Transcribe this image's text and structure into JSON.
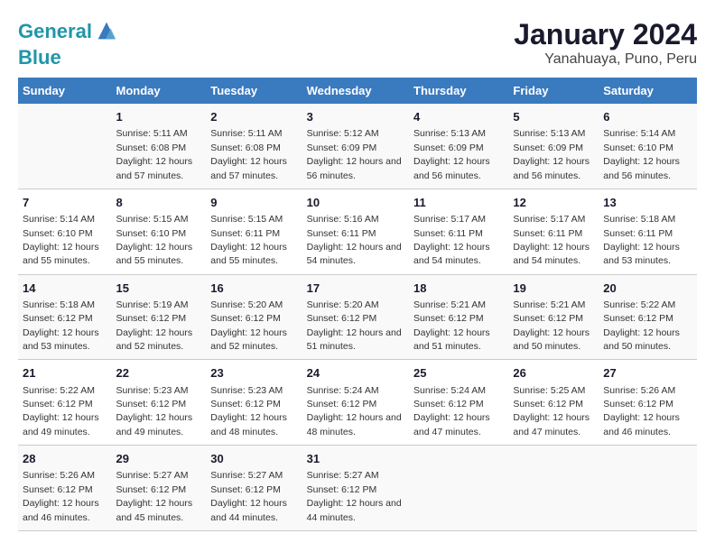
{
  "logo": {
    "line1": "General",
    "line2": "Blue"
  },
  "title": "January 2024",
  "subtitle": "Yanahuaya, Puno, Peru",
  "days_header": [
    "Sunday",
    "Monday",
    "Tuesday",
    "Wednesday",
    "Thursday",
    "Friday",
    "Saturday"
  ],
  "weeks": [
    [
      {
        "num": "",
        "sunrise": "",
        "sunset": "",
        "daylight": ""
      },
      {
        "num": "1",
        "sunrise": "Sunrise: 5:11 AM",
        "sunset": "Sunset: 6:08 PM",
        "daylight": "Daylight: 12 hours and 57 minutes."
      },
      {
        "num": "2",
        "sunrise": "Sunrise: 5:11 AM",
        "sunset": "Sunset: 6:08 PM",
        "daylight": "Daylight: 12 hours and 57 minutes."
      },
      {
        "num": "3",
        "sunrise": "Sunrise: 5:12 AM",
        "sunset": "Sunset: 6:09 PM",
        "daylight": "Daylight: 12 hours and 56 minutes."
      },
      {
        "num": "4",
        "sunrise": "Sunrise: 5:13 AM",
        "sunset": "Sunset: 6:09 PM",
        "daylight": "Daylight: 12 hours and 56 minutes."
      },
      {
        "num": "5",
        "sunrise": "Sunrise: 5:13 AM",
        "sunset": "Sunset: 6:09 PM",
        "daylight": "Daylight: 12 hours and 56 minutes."
      },
      {
        "num": "6",
        "sunrise": "Sunrise: 5:14 AM",
        "sunset": "Sunset: 6:10 PM",
        "daylight": "Daylight: 12 hours and 56 minutes."
      }
    ],
    [
      {
        "num": "7",
        "sunrise": "Sunrise: 5:14 AM",
        "sunset": "Sunset: 6:10 PM",
        "daylight": "Daylight: 12 hours and 55 minutes."
      },
      {
        "num": "8",
        "sunrise": "Sunrise: 5:15 AM",
        "sunset": "Sunset: 6:10 PM",
        "daylight": "Daylight: 12 hours and 55 minutes."
      },
      {
        "num": "9",
        "sunrise": "Sunrise: 5:15 AM",
        "sunset": "Sunset: 6:11 PM",
        "daylight": "Daylight: 12 hours and 55 minutes."
      },
      {
        "num": "10",
        "sunrise": "Sunrise: 5:16 AM",
        "sunset": "Sunset: 6:11 PM",
        "daylight": "Daylight: 12 hours and 54 minutes."
      },
      {
        "num": "11",
        "sunrise": "Sunrise: 5:17 AM",
        "sunset": "Sunset: 6:11 PM",
        "daylight": "Daylight: 12 hours and 54 minutes."
      },
      {
        "num": "12",
        "sunrise": "Sunrise: 5:17 AM",
        "sunset": "Sunset: 6:11 PM",
        "daylight": "Daylight: 12 hours and 54 minutes."
      },
      {
        "num": "13",
        "sunrise": "Sunrise: 5:18 AM",
        "sunset": "Sunset: 6:11 PM",
        "daylight": "Daylight: 12 hours and 53 minutes."
      }
    ],
    [
      {
        "num": "14",
        "sunrise": "Sunrise: 5:18 AM",
        "sunset": "Sunset: 6:12 PM",
        "daylight": "Daylight: 12 hours and 53 minutes."
      },
      {
        "num": "15",
        "sunrise": "Sunrise: 5:19 AM",
        "sunset": "Sunset: 6:12 PM",
        "daylight": "Daylight: 12 hours and 52 minutes."
      },
      {
        "num": "16",
        "sunrise": "Sunrise: 5:20 AM",
        "sunset": "Sunset: 6:12 PM",
        "daylight": "Daylight: 12 hours and 52 minutes."
      },
      {
        "num": "17",
        "sunrise": "Sunrise: 5:20 AM",
        "sunset": "Sunset: 6:12 PM",
        "daylight": "Daylight: 12 hours and 51 minutes."
      },
      {
        "num": "18",
        "sunrise": "Sunrise: 5:21 AM",
        "sunset": "Sunset: 6:12 PM",
        "daylight": "Daylight: 12 hours and 51 minutes."
      },
      {
        "num": "19",
        "sunrise": "Sunrise: 5:21 AM",
        "sunset": "Sunset: 6:12 PM",
        "daylight": "Daylight: 12 hours and 50 minutes."
      },
      {
        "num": "20",
        "sunrise": "Sunrise: 5:22 AM",
        "sunset": "Sunset: 6:12 PM",
        "daylight": "Daylight: 12 hours and 50 minutes."
      }
    ],
    [
      {
        "num": "21",
        "sunrise": "Sunrise: 5:22 AM",
        "sunset": "Sunset: 6:12 PM",
        "daylight": "Daylight: 12 hours and 49 minutes."
      },
      {
        "num": "22",
        "sunrise": "Sunrise: 5:23 AM",
        "sunset": "Sunset: 6:12 PM",
        "daylight": "Daylight: 12 hours and 49 minutes."
      },
      {
        "num": "23",
        "sunrise": "Sunrise: 5:23 AM",
        "sunset": "Sunset: 6:12 PM",
        "daylight": "Daylight: 12 hours and 48 minutes."
      },
      {
        "num": "24",
        "sunrise": "Sunrise: 5:24 AM",
        "sunset": "Sunset: 6:12 PM",
        "daylight": "Daylight: 12 hours and 48 minutes."
      },
      {
        "num": "25",
        "sunrise": "Sunrise: 5:24 AM",
        "sunset": "Sunset: 6:12 PM",
        "daylight": "Daylight: 12 hours and 47 minutes."
      },
      {
        "num": "26",
        "sunrise": "Sunrise: 5:25 AM",
        "sunset": "Sunset: 6:12 PM",
        "daylight": "Daylight: 12 hours and 47 minutes."
      },
      {
        "num": "27",
        "sunrise": "Sunrise: 5:26 AM",
        "sunset": "Sunset: 6:12 PM",
        "daylight": "Daylight: 12 hours and 46 minutes."
      }
    ],
    [
      {
        "num": "28",
        "sunrise": "Sunrise: 5:26 AM",
        "sunset": "Sunset: 6:12 PM",
        "daylight": "Daylight: 12 hours and 46 minutes."
      },
      {
        "num": "29",
        "sunrise": "Sunrise: 5:27 AM",
        "sunset": "Sunset: 6:12 PM",
        "daylight": "Daylight: 12 hours and 45 minutes."
      },
      {
        "num": "30",
        "sunrise": "Sunrise: 5:27 AM",
        "sunset": "Sunset: 6:12 PM",
        "daylight": "Daylight: 12 hours and 44 minutes."
      },
      {
        "num": "31",
        "sunrise": "Sunrise: 5:27 AM",
        "sunset": "Sunset: 6:12 PM",
        "daylight": "Daylight: 12 hours and 44 minutes."
      },
      {
        "num": "",
        "sunrise": "",
        "sunset": "",
        "daylight": ""
      },
      {
        "num": "",
        "sunrise": "",
        "sunset": "",
        "daylight": ""
      },
      {
        "num": "",
        "sunrise": "",
        "sunset": "",
        "daylight": ""
      }
    ]
  ]
}
